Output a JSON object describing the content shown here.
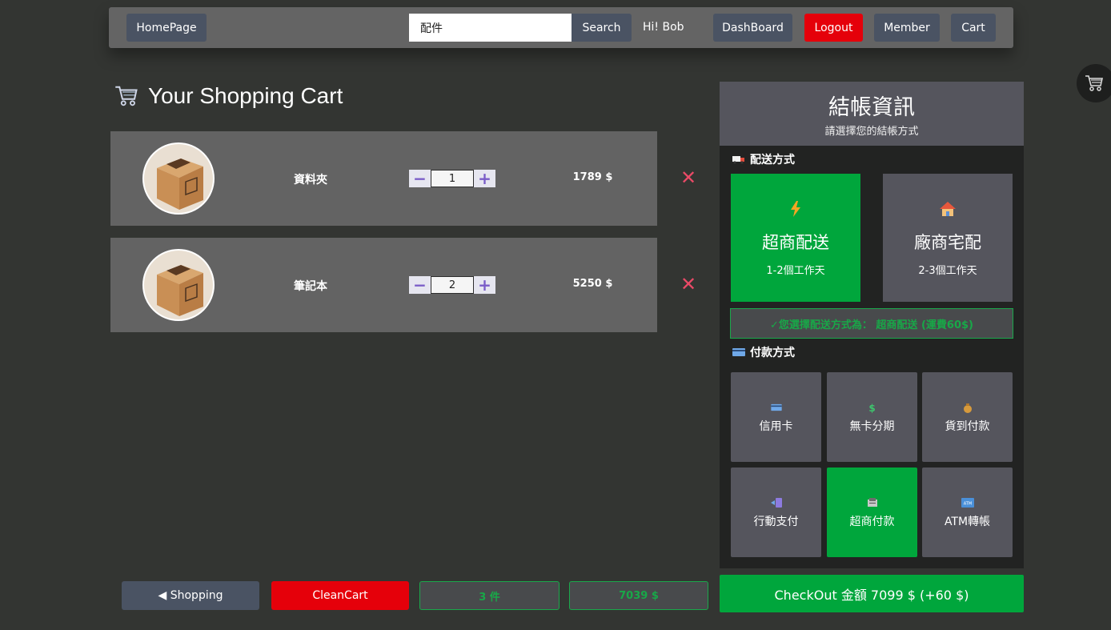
{
  "nav": {
    "home": "HomePage",
    "search_value": "配件",
    "search_button": "Search",
    "greeting": "Hi! Bob",
    "dashboard": "DashBoard",
    "logout": "Logout",
    "member": "Member",
    "cart": "Cart"
  },
  "cart": {
    "title": "Your Shopping Cart",
    "items": [
      {
        "name": "資料夾",
        "qty": "1",
        "price": "1789 $"
      },
      {
        "name": "筆記本",
        "qty": "2",
        "price": "5250 $"
      }
    ]
  },
  "bottom": {
    "shopping": "◀ Shopping",
    "clean": "CleanCart",
    "count": "3 件",
    "total": "7039 $"
  },
  "checkout": {
    "title": "結帳資訊",
    "subtitle": "請選擇您的結帳方式",
    "shipping_label": "配送方式",
    "shipping_options": [
      {
        "icon": "lightning-icon",
        "name": "超商配送",
        "days": "1-2個工作天",
        "selected": true
      },
      {
        "icon": "house-icon",
        "name": "廠商宅配",
        "days": "2-3個工作天",
        "selected": false
      }
    ],
    "shipping_message": "✓您選擇配送方式為： 超商配送 (運費60$)",
    "payment_label": "付款方式",
    "payment_options": [
      {
        "icon": "credit-card-icon",
        "name": "信用卡",
        "selected": false
      },
      {
        "icon": "dollar-icon",
        "name": "無卡分期",
        "selected": false
      },
      {
        "icon": "money-bag-icon",
        "name": "貨到付款",
        "selected": false
      },
      {
        "icon": "mobile-pay-icon",
        "name": "行動支付",
        "selected": false
      },
      {
        "icon": "store-register-icon",
        "name": "超商付款",
        "selected": true
      },
      {
        "icon": "atm-icon",
        "name": "ATM轉帳",
        "selected": false
      }
    ],
    "checkout_button": "CheckOut 金額 7099 $ (+60 $)"
  },
  "colors": {
    "background": "#333532",
    "selected": "#00a63c",
    "danger": "#e5000a",
    "dark_button": "#4a5363"
  }
}
